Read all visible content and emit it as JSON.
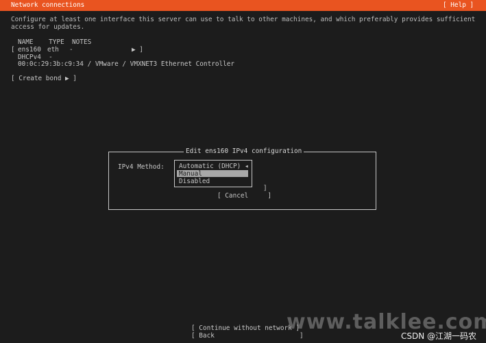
{
  "header": {
    "title": "Network connections",
    "help": "[ Help ]"
  },
  "description": {
    "line1": "Configure at least one interface this server can use to talk to other machines, and which preferably provides sufficient",
    "line2": "access for updates."
  },
  "table": {
    "header": "NAME    TYPE  NOTES",
    "row_bracket_open": "[",
    "row_name": "ens160",
    "row_type": "eth",
    "row_notes": "-",
    "row_arrow": "▶ ]",
    "dhcp": "DHCPv4  -",
    "mac_line": "00:0c:29:3b:c9:34 / VMware / VMXNET3 Ethernet Controller"
  },
  "create_bond": "[ Create bond ▶ ]",
  "modal": {
    "title": "Edit ens160 IPv4 configuration",
    "method_label": "IPv4 Method:",
    "options": [
      "Automatic (DHCP) ◂",
      "Manual",
      "Disabled"
    ],
    "hidden_bracket": "]",
    "cancel": "[ Cancel     ]"
  },
  "footer": {
    "continue": "[ Continue without network ]",
    "back": "[ Back                      ]"
  },
  "watermark": {
    "site": "www.talklee.com",
    "csdn": "CSDN @江湖一码农"
  },
  "colors": {
    "accent": "#e95420",
    "background": "#1c1c1c",
    "text": "#c8c8c8"
  }
}
